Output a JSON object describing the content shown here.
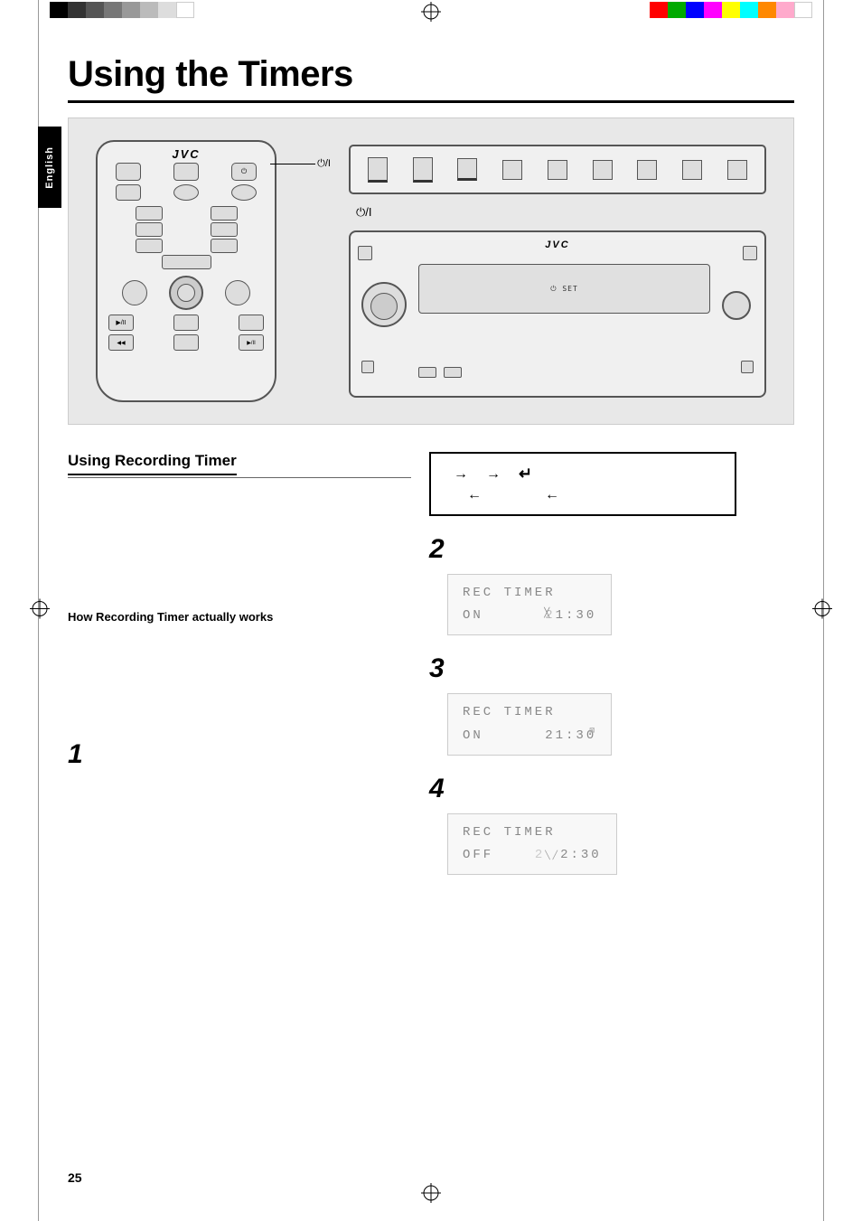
{
  "page": {
    "title": "Using the Timers",
    "page_number": "25",
    "language_tab": "English"
  },
  "top_bar": {
    "color_blocks_left": [
      "#000",
      "#333",
      "#555",
      "#777",
      "#999",
      "#bbb",
      "#ddd",
      "#fff"
    ],
    "color_blocks_right": [
      "#ff0000",
      "#00aa00",
      "#0000ff",
      "#ff00ff",
      "#ffff00",
      "#00ffff",
      "#ff8800",
      "#ff88cc",
      "#fff"
    ]
  },
  "diagram": {
    "remote": {
      "brand": "JVC",
      "power_label": "⏻/I"
    },
    "vcr": {
      "brand": "JVC",
      "power_label": "⏻/I"
    }
  },
  "sections": {
    "using_recording_timer": {
      "heading": "Using Recording Timer",
      "sub_heading": "How Recording Timer actually works",
      "steps": [
        {
          "number": "1",
          "text": ""
        },
        {
          "number": "2",
          "text": ""
        },
        {
          "number": "3",
          "text": ""
        },
        {
          "number": "4",
          "text": ""
        }
      ],
      "lcd_displays": [
        {
          "line1": "REC TIMER",
          "line2": "ON      21:30"
        },
        {
          "line1": "REC TIMER",
          "line2": "ON      21:30"
        },
        {
          "line1": "REC TIMER",
          "line2": "OFF     22:30"
        }
      ]
    }
  },
  "flow": {
    "arrows_top": [
      "→",
      "→"
    ],
    "arrows_bottom": [
      "←",
      "←"
    ],
    "return_arrow": "↵"
  }
}
